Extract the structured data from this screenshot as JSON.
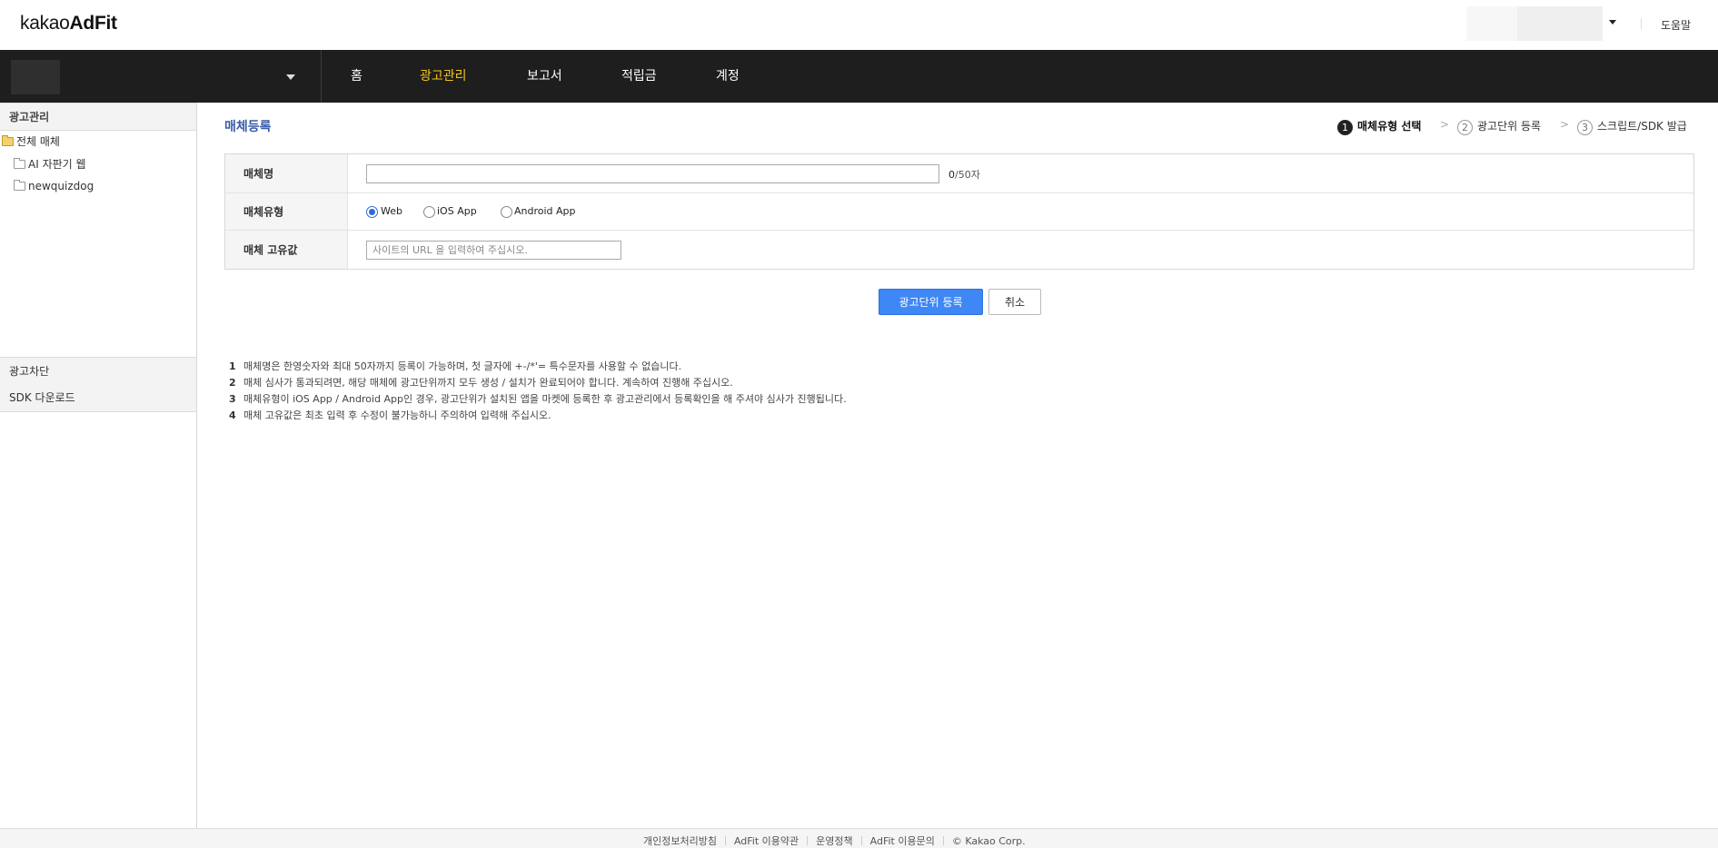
{
  "header": {
    "logo_prefix": "kakao",
    "logo_suffix": "AdFit",
    "help": "도움말"
  },
  "nav": {
    "items": [
      {
        "label": "홈"
      },
      {
        "label": "광고관리",
        "active": true
      },
      {
        "label": "보고서"
      },
      {
        "label": "적립금"
      },
      {
        "label": "계정"
      }
    ]
  },
  "sidebar": {
    "ad_manage": "광고관리",
    "tree": [
      {
        "label": "전체 매체",
        "icon": "folder-open-icon"
      },
      {
        "label": "AI 자판기 웹",
        "icon": "folder-icon"
      },
      {
        "label": "newquizdog",
        "icon": "folder-icon"
      }
    ],
    "ad_block": "광고차단",
    "sdk_download": "SDK 다운로드"
  },
  "page": {
    "title": "매체등록",
    "steps": [
      {
        "num": "1",
        "label": "매체유형 선택",
        "active": true
      },
      {
        "num": "2",
        "label": "광고단위 등록"
      },
      {
        "num": "3",
        "label": "스크립트/SDK 발급"
      }
    ]
  },
  "form": {
    "name_label": "매체명",
    "name_value": "",
    "name_count": "0",
    "name_max": "/50자",
    "type_label": "매체유형",
    "types": [
      "Web",
      "iOS App",
      "Android App"
    ],
    "selected_type": "Web",
    "unique_label": "매체 고유값",
    "unique_placeholder": "사이트의 URL 을 입력하여 주십시오."
  },
  "buttons": {
    "register": "광고단위 등록",
    "cancel": "취소"
  },
  "notes": [
    {
      "num": "1",
      "text": "매체명은 한영숫자와 최대 50자까지 등록이 가능하며, 첫 글자에 +-/*'= 특수문자를 사용할 수 없습니다."
    },
    {
      "num": "2",
      "text": "매체 심사가 통과되려면, 해당 매체에 광고단위까지 모두 생성 / 설치가 완료되어야 합니다. 계속하여 진행해 주십시오."
    },
    {
      "num": "3",
      "text": "매체유형이 iOS App / Android App인 경우, 광고단위가 설치된 앱을 마켓에 등록한 후 광고관리에서 등록확인을 해 주셔야 심사가 진행됩니다."
    },
    {
      "num": "4",
      "text": "매체 고유값은 최초 입력 후 수정이 불가능하니 주의하여 입력해 주십시오."
    }
  ],
  "footer": {
    "links": [
      "개인정보처리방침",
      "AdFit 이용약관",
      "운영정책",
      "AdFit 이용문의"
    ],
    "copyright": "© Kakao Corp."
  },
  "colors": {
    "nav_bg": "#1e1e1e",
    "nav_active": "#f5c518",
    "title_blue": "#3a5aa8",
    "primary_button": "#3f87f5"
  }
}
